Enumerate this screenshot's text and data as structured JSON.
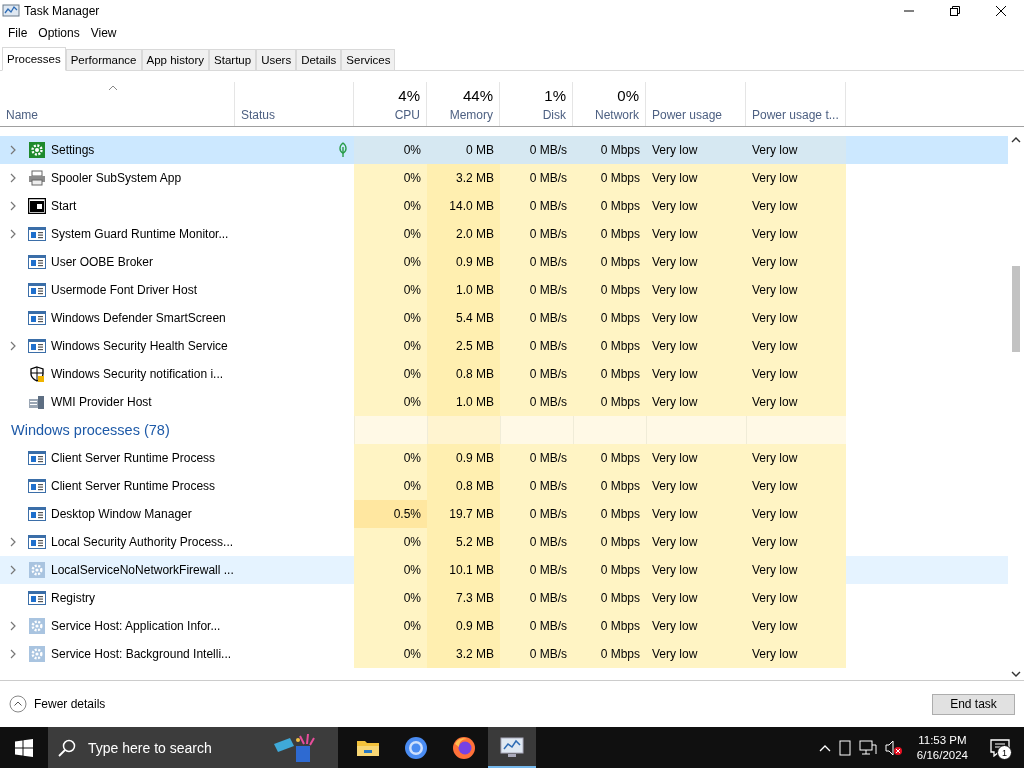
{
  "window": {
    "title": "Task Manager"
  },
  "menu": [
    "File",
    "Options",
    "View"
  ],
  "tabs": [
    {
      "label": "Processes",
      "selected": true
    },
    {
      "label": "Performance",
      "selected": false
    },
    {
      "label": "App history",
      "selected": false
    },
    {
      "label": "Startup",
      "selected": false
    },
    {
      "label": "Users",
      "selected": false
    },
    {
      "label": "Details",
      "selected": false
    },
    {
      "label": "Services",
      "selected": false
    }
  ],
  "columns": [
    {
      "label": "Name"
    },
    {
      "label": "Status"
    },
    {
      "label": "CPU",
      "percent": "4%"
    },
    {
      "label": "Memory",
      "percent": "44%"
    },
    {
      "label": "Disk",
      "percent": "1%"
    },
    {
      "label": "Network",
      "percent": "0%"
    },
    {
      "label": "Power usage"
    },
    {
      "label": "Power usage t..."
    }
  ],
  "sections": [
    {
      "rows": [
        {
          "kind": "settings",
          "name": "Settings",
          "expandable": true,
          "selected": true,
          "hovered": false,
          "efficiency_mode": true,
          "cpu_hot": false,
          "cpu": "0%",
          "memory": "0 MB",
          "disk": "0 MB/s",
          "network": "0 Mbps",
          "power": "Very low",
          "power_trend": "Very low"
        },
        {
          "kind": "printer",
          "name": "Spooler SubSystem App",
          "expandable": true,
          "selected": false,
          "hovered": false,
          "efficiency_mode": false,
          "cpu_hot": false,
          "cpu": "0%",
          "memory": "3.2 MB",
          "disk": "0 MB/s",
          "network": "0 Mbps",
          "power": "Very low",
          "power_trend": "Very low"
        },
        {
          "kind": "start",
          "name": "Start",
          "expandable": true,
          "selected": false,
          "hovered": false,
          "efficiency_mode": false,
          "cpu_hot": false,
          "cpu": "0%",
          "memory": "14.0 MB",
          "disk": "0 MB/s",
          "network": "0 Mbps",
          "power": "Very low",
          "power_trend": "Very low"
        },
        {
          "kind": "app",
          "name": "System Guard Runtime Monitor...",
          "expandable": true,
          "selected": false,
          "hovered": false,
          "efficiency_mode": false,
          "cpu_hot": false,
          "cpu": "0%",
          "memory": "2.0 MB",
          "disk": "0 MB/s",
          "network": "0 Mbps",
          "power": "Very low",
          "power_trend": "Very low"
        },
        {
          "kind": "app",
          "name": "User OOBE Broker",
          "expandable": false,
          "selected": false,
          "hovered": false,
          "efficiency_mode": false,
          "cpu_hot": false,
          "cpu": "0%",
          "memory": "0.9 MB",
          "disk": "0 MB/s",
          "network": "0 Mbps",
          "power": "Very low",
          "power_trend": "Very low"
        },
        {
          "kind": "app",
          "name": "Usermode Font Driver Host",
          "expandable": false,
          "selected": false,
          "hovered": false,
          "efficiency_mode": false,
          "cpu_hot": false,
          "cpu": "0%",
          "memory": "1.0 MB",
          "disk": "0 MB/s",
          "network": "0 Mbps",
          "power": "Very low",
          "power_trend": "Very low"
        },
        {
          "kind": "app",
          "name": "Windows Defender SmartScreen",
          "expandable": false,
          "selected": false,
          "hovered": false,
          "efficiency_mode": false,
          "cpu_hot": false,
          "cpu": "0%",
          "memory": "5.4 MB",
          "disk": "0 MB/s",
          "network": "0 Mbps",
          "power": "Very low",
          "power_trend": "Very low"
        },
        {
          "kind": "app",
          "name": "Windows Security Health Service",
          "expandable": true,
          "selected": false,
          "hovered": false,
          "efficiency_mode": false,
          "cpu_hot": false,
          "cpu": "0%",
          "memory": "2.5 MB",
          "disk": "0 MB/s",
          "network": "0 Mbps",
          "power": "Very low",
          "power_trend": "Very low"
        },
        {
          "kind": "shield",
          "name": "Windows Security notification i...",
          "expandable": false,
          "selected": false,
          "hovered": false,
          "efficiency_mode": false,
          "cpu_hot": false,
          "cpu": "0%",
          "memory": "0.8 MB",
          "disk": "0 MB/s",
          "network": "0 Mbps",
          "power": "Very low",
          "power_trend": "Very low"
        },
        {
          "kind": "server",
          "name": "WMI Provider Host",
          "expandable": false,
          "selected": false,
          "hovered": false,
          "efficiency_mode": false,
          "cpu_hot": false,
          "cpu": "0%",
          "memory": "1.0 MB",
          "disk": "0 MB/s",
          "network": "0 Mbps",
          "power": "Very low",
          "power_trend": "Very low"
        }
      ]
    },
    {
      "title": "Windows processes (78)",
      "rows": [
        {
          "kind": "app",
          "name": "Client Server Runtime Process",
          "expandable": false,
          "selected": false,
          "hovered": false,
          "efficiency_mode": false,
          "cpu_hot": false,
          "cpu": "0%",
          "memory": "0.9 MB",
          "disk": "0 MB/s",
          "network": "0 Mbps",
          "power": "Very low",
          "power_trend": "Very low"
        },
        {
          "kind": "app",
          "name": "Client Server Runtime Process",
          "expandable": false,
          "selected": false,
          "hovered": false,
          "efficiency_mode": false,
          "cpu_hot": false,
          "cpu": "0%",
          "memory": "0.8 MB",
          "disk": "0 MB/s",
          "network": "0 Mbps",
          "power": "Very low",
          "power_trend": "Very low"
        },
        {
          "kind": "app",
          "name": "Desktop Window Manager",
          "expandable": false,
          "selected": false,
          "hovered": false,
          "efficiency_mode": false,
          "cpu_hot": true,
          "cpu": "0.5%",
          "memory": "19.7 MB",
          "disk": "0 MB/s",
          "network": "0 Mbps",
          "power": "Very low",
          "power_trend": "Very low"
        },
        {
          "kind": "app",
          "name": "Local Security Authority Process...",
          "expandable": true,
          "selected": false,
          "hovered": false,
          "efficiency_mode": false,
          "cpu_hot": false,
          "cpu": "0%",
          "memory": "5.2 MB",
          "disk": "0 MB/s",
          "network": "0 Mbps",
          "power": "Very low",
          "power_trend": "Very low"
        },
        {
          "kind": "service",
          "name": "LocalServiceNoNetworkFirewall ...",
          "expandable": true,
          "selected": false,
          "hovered": true,
          "efficiency_mode": false,
          "cpu_hot": false,
          "cpu": "0%",
          "memory": "10.1 MB",
          "disk": "0 MB/s",
          "network": "0 Mbps",
          "power": "Very low",
          "power_trend": "Very low"
        },
        {
          "kind": "app",
          "name": "Registry",
          "expandable": false,
          "selected": false,
          "hovered": false,
          "efficiency_mode": false,
          "cpu_hot": false,
          "cpu": "0%",
          "memory": "7.3 MB",
          "disk": "0 MB/s",
          "network": "0 Mbps",
          "power": "Very low",
          "power_trend": "Very low"
        },
        {
          "kind": "service",
          "name": "Service Host: Application Infor...",
          "expandable": true,
          "selected": false,
          "hovered": false,
          "efficiency_mode": false,
          "cpu_hot": false,
          "cpu": "0%",
          "memory": "0.9 MB",
          "disk": "0 MB/s",
          "network": "0 Mbps",
          "power": "Very low",
          "power_trend": "Very low"
        },
        {
          "kind": "service",
          "name": "Service Host: Background Intelli...",
          "expandable": true,
          "selected": false,
          "hovered": false,
          "efficiency_mode": false,
          "cpu_hot": false,
          "cpu": "0%",
          "memory": "3.2 MB",
          "disk": "0 MB/s",
          "network": "0 Mbps",
          "power": "Very low",
          "power_trend": "Very low"
        }
      ]
    }
  ],
  "footer": {
    "details_toggle": "Fewer details",
    "end_task": "End task"
  },
  "taskbar": {
    "search_placeholder": "Type here to search",
    "time": "11:53 PM",
    "date": "6/16/2024",
    "notification_count": "1"
  }
}
